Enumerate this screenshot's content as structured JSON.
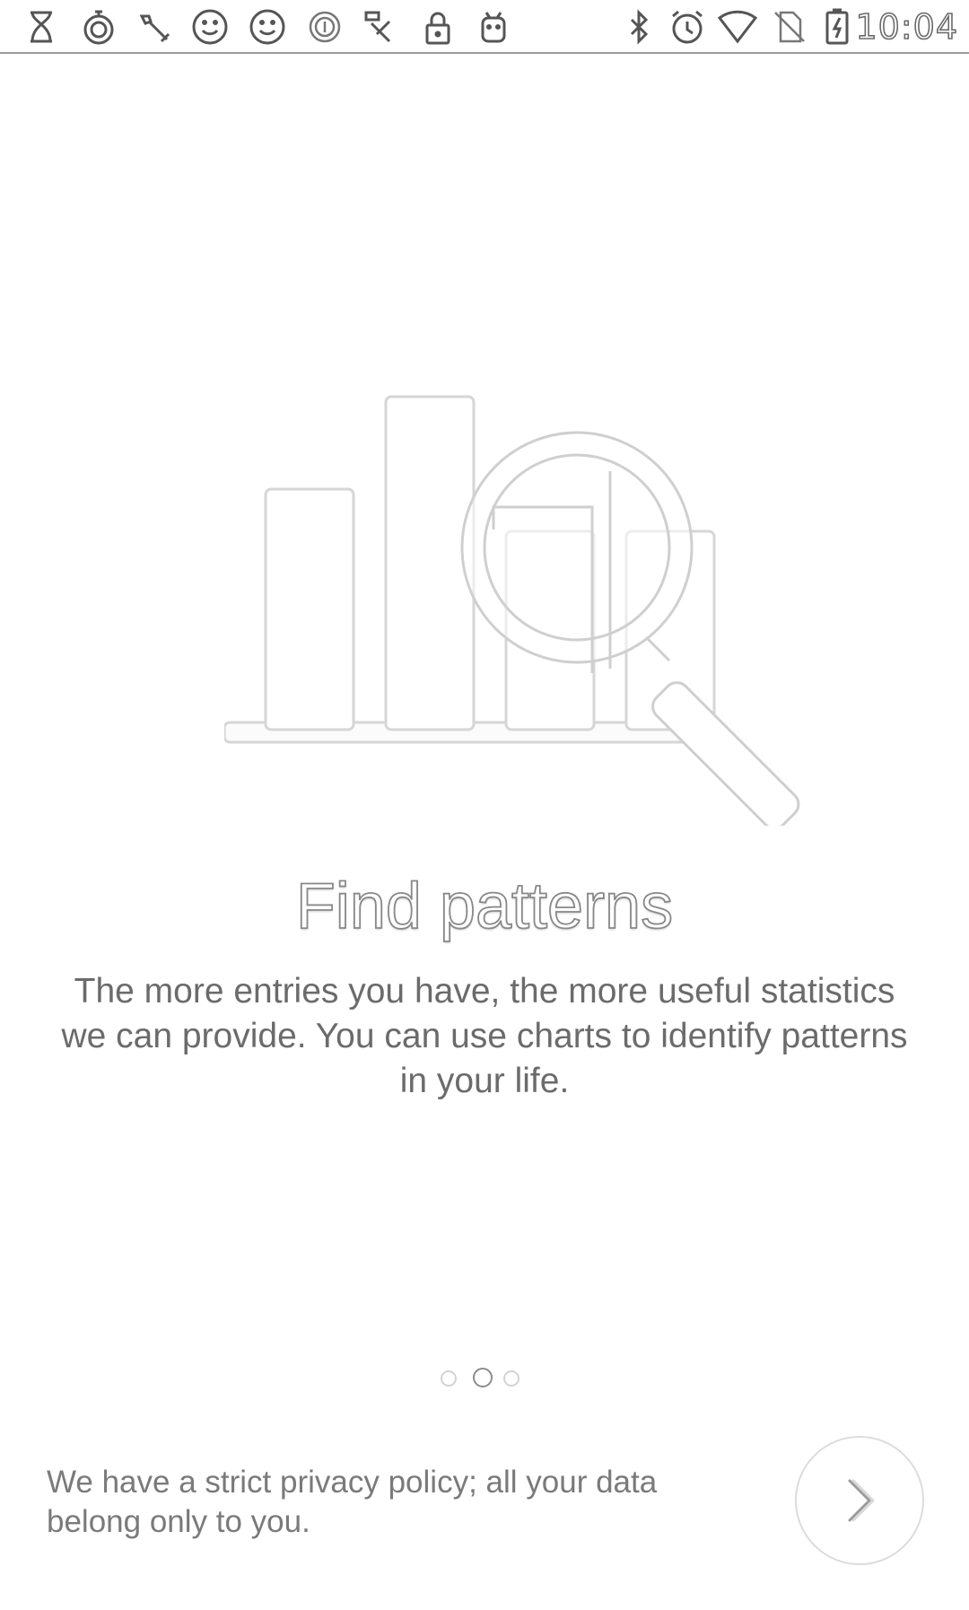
{
  "status_bar": {
    "left_icons": [
      "hourglass-icon",
      "stopwatch-icon",
      "wrench-icon",
      "smiley-icon",
      "smiley-icon",
      "circle-badge-icon",
      "app-badge-icon",
      "lock-icon",
      "android-icon"
    ],
    "right_icons": [
      "bluetooth-icon",
      "alarm-icon",
      "wifi-icon",
      "no-sim-icon",
      "battery-charging-icon"
    ],
    "time": "10:04"
  },
  "onboarding": {
    "illustration_icon": "bar-chart-magnifier-icon",
    "title": "Find patterns",
    "description": "The more entries you have, the more useful statistics we can provide. You can use charts to identify patterns in your life.",
    "page_count": 3,
    "active_page": 2
  },
  "footer": {
    "privacy_text": "We have a strict privacy policy; all your data belong only to you.",
    "next_icon": "chevron-right-icon"
  }
}
